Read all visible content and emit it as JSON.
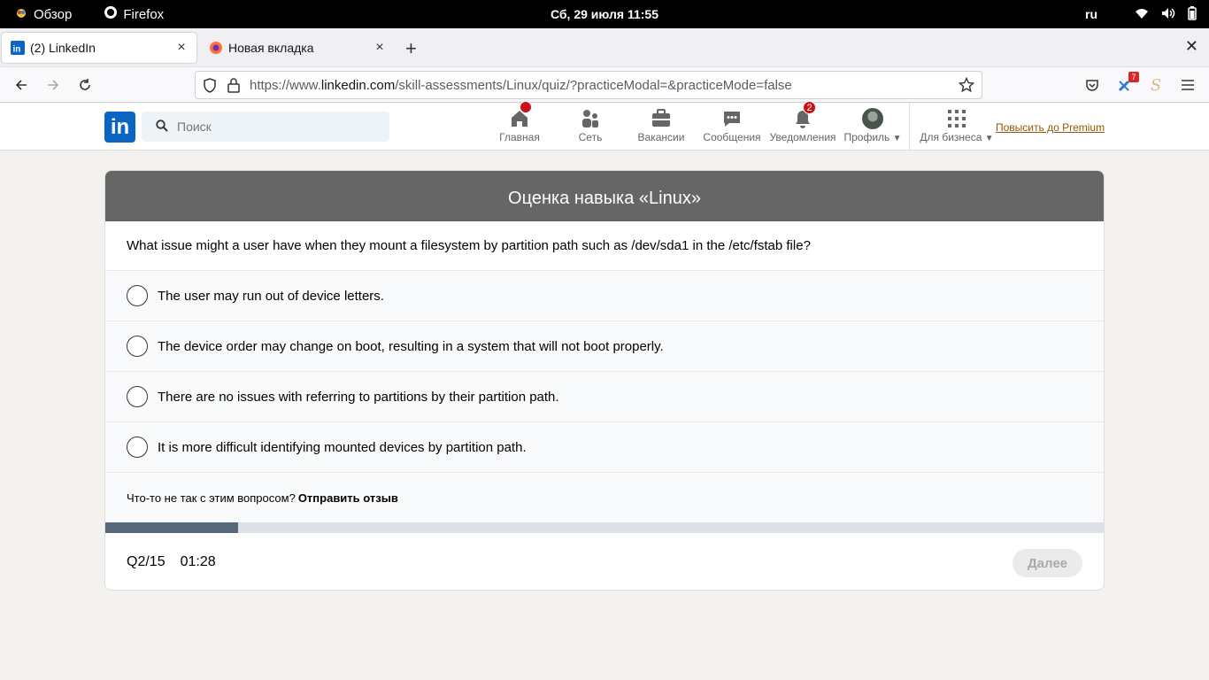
{
  "system": {
    "activities": "Обзор",
    "app": "Firefox",
    "clock": "Сб, 29 июля  11:55",
    "lang": "ru"
  },
  "browser": {
    "tabs": [
      {
        "title": "(2) LinkedIn",
        "active": true
      },
      {
        "title": "Новая вкладка",
        "active": false
      }
    ],
    "url_prefix": "https://www.",
    "url_domain": "linkedin.com",
    "url_rest": "/skill-assessments/Linux/quiz/?practiceModal=&practiceMode=false",
    "extension_badge": "7"
  },
  "linkedin": {
    "search_placeholder": "Поиск",
    "nav": [
      {
        "label": "Главная",
        "badge": ""
      },
      {
        "label": "Сеть",
        "badge": ""
      },
      {
        "label": "Вакансии",
        "badge": ""
      },
      {
        "label": "Сообщения",
        "badge": ""
      },
      {
        "label": "Уведомления",
        "badge": "2"
      },
      {
        "label": "Профиль",
        "badge": ""
      },
      {
        "label": "Для бизнеса",
        "badge": ""
      }
    ],
    "premium": "Повысить до Premium"
  },
  "quiz": {
    "title": "Оценка навыка «Linux»",
    "question": "What issue might a user have when they mount a filesystem by partition path such as /dev/sda1 in the /etc/fstab file?",
    "options": [
      "The user may run out of device letters.",
      "The device order may change on boot, resulting in a system that will not boot properly.",
      "There are no issues with referring to partitions by their partition path.",
      "It is more difficult identifying mounted devices by partition path."
    ],
    "feedback_prompt": "Что-то не так с этим вопросом?",
    "feedback_link": "Отправить отзыв",
    "progress_fraction": 0.133,
    "counter": "Q2/15",
    "timer": "01:28",
    "next_label": "Далее"
  },
  "colors": {
    "linkedin_blue": "#0a66c2",
    "card_header": "#666666",
    "progress_fill": "#56687a",
    "notification_red": "#cc1016"
  }
}
